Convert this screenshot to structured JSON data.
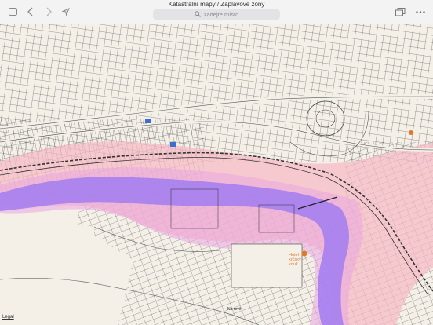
{
  "window": {
    "title": "Katastrální mapy / Záplavové zóny"
  },
  "search": {
    "placeholder": "zadejte místo"
  },
  "toolbar": {
    "icons": [
      "sidebar-icon",
      "back-icon",
      "forward-icon",
      "location-arrow-icon",
      "layers-icon",
      "more-icon"
    ]
  },
  "map": {
    "street_label": "Na rově",
    "poi_label": "Hotel\nkrčský\nkouk",
    "legal_label": "Legal",
    "colors": {
      "background": "#f4f0e8",
      "flood_pink": "#f7b8c4",
      "flood_purple": "#a57ff0",
      "parcel_line": "#333333",
      "poi_orange": "#e07828"
    }
  }
}
